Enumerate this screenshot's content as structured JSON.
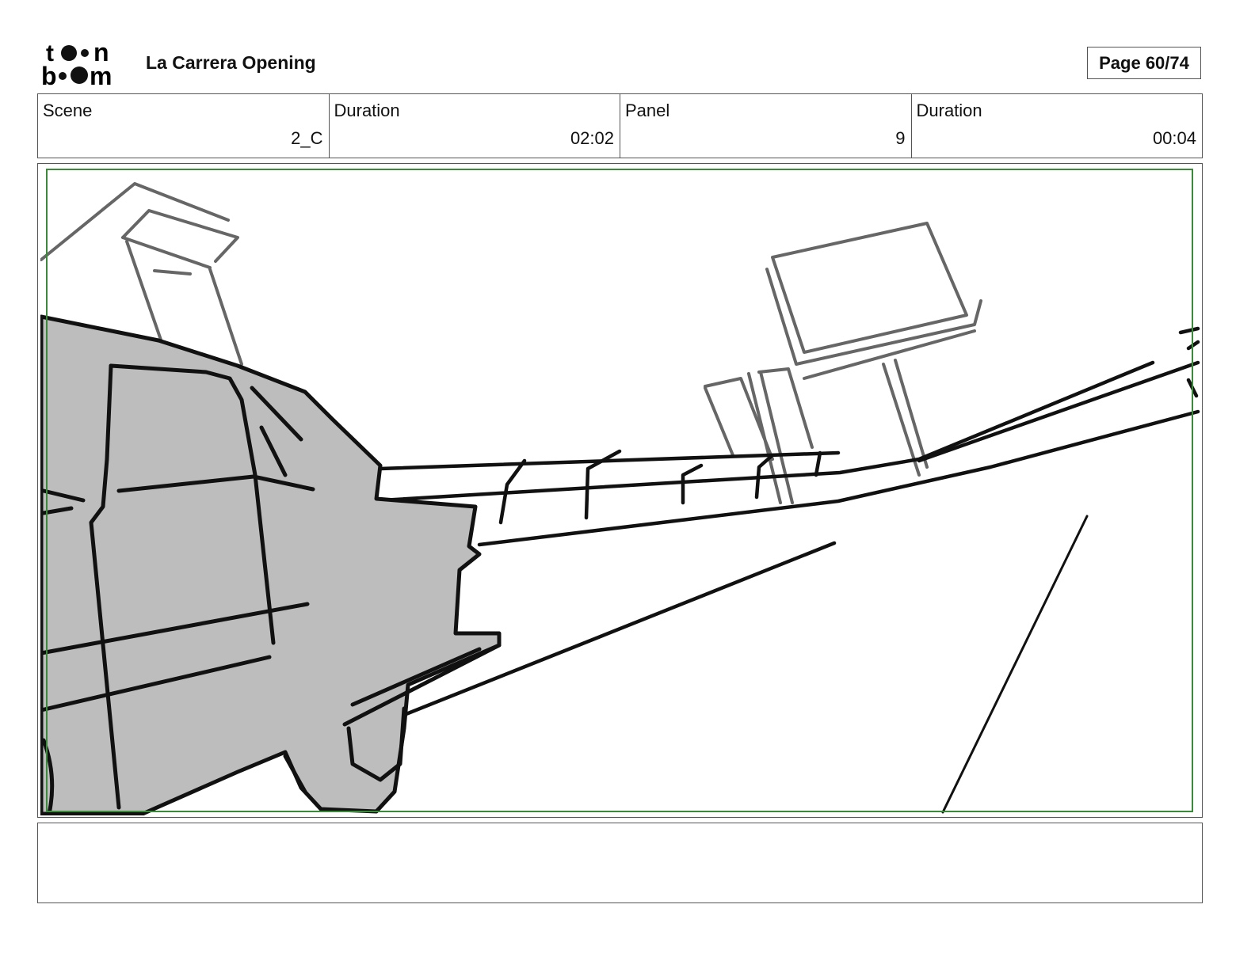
{
  "header": {
    "logo_text": "toon boom",
    "project_title": "La Carrera Opening",
    "page_label": "Page 60/74"
  },
  "info": [
    {
      "label": "Scene",
      "value": "2_C"
    },
    {
      "label": "Duration",
      "value": "02:02"
    },
    {
      "label": "Panel",
      "value": "9"
    },
    {
      "label": "Duration",
      "value": "00:04"
    }
  ],
  "colors": {
    "safe_frame": "#3a8a3a",
    "car_fill": "#bdbdbd"
  },
  "caption": {
    "text": ""
  }
}
